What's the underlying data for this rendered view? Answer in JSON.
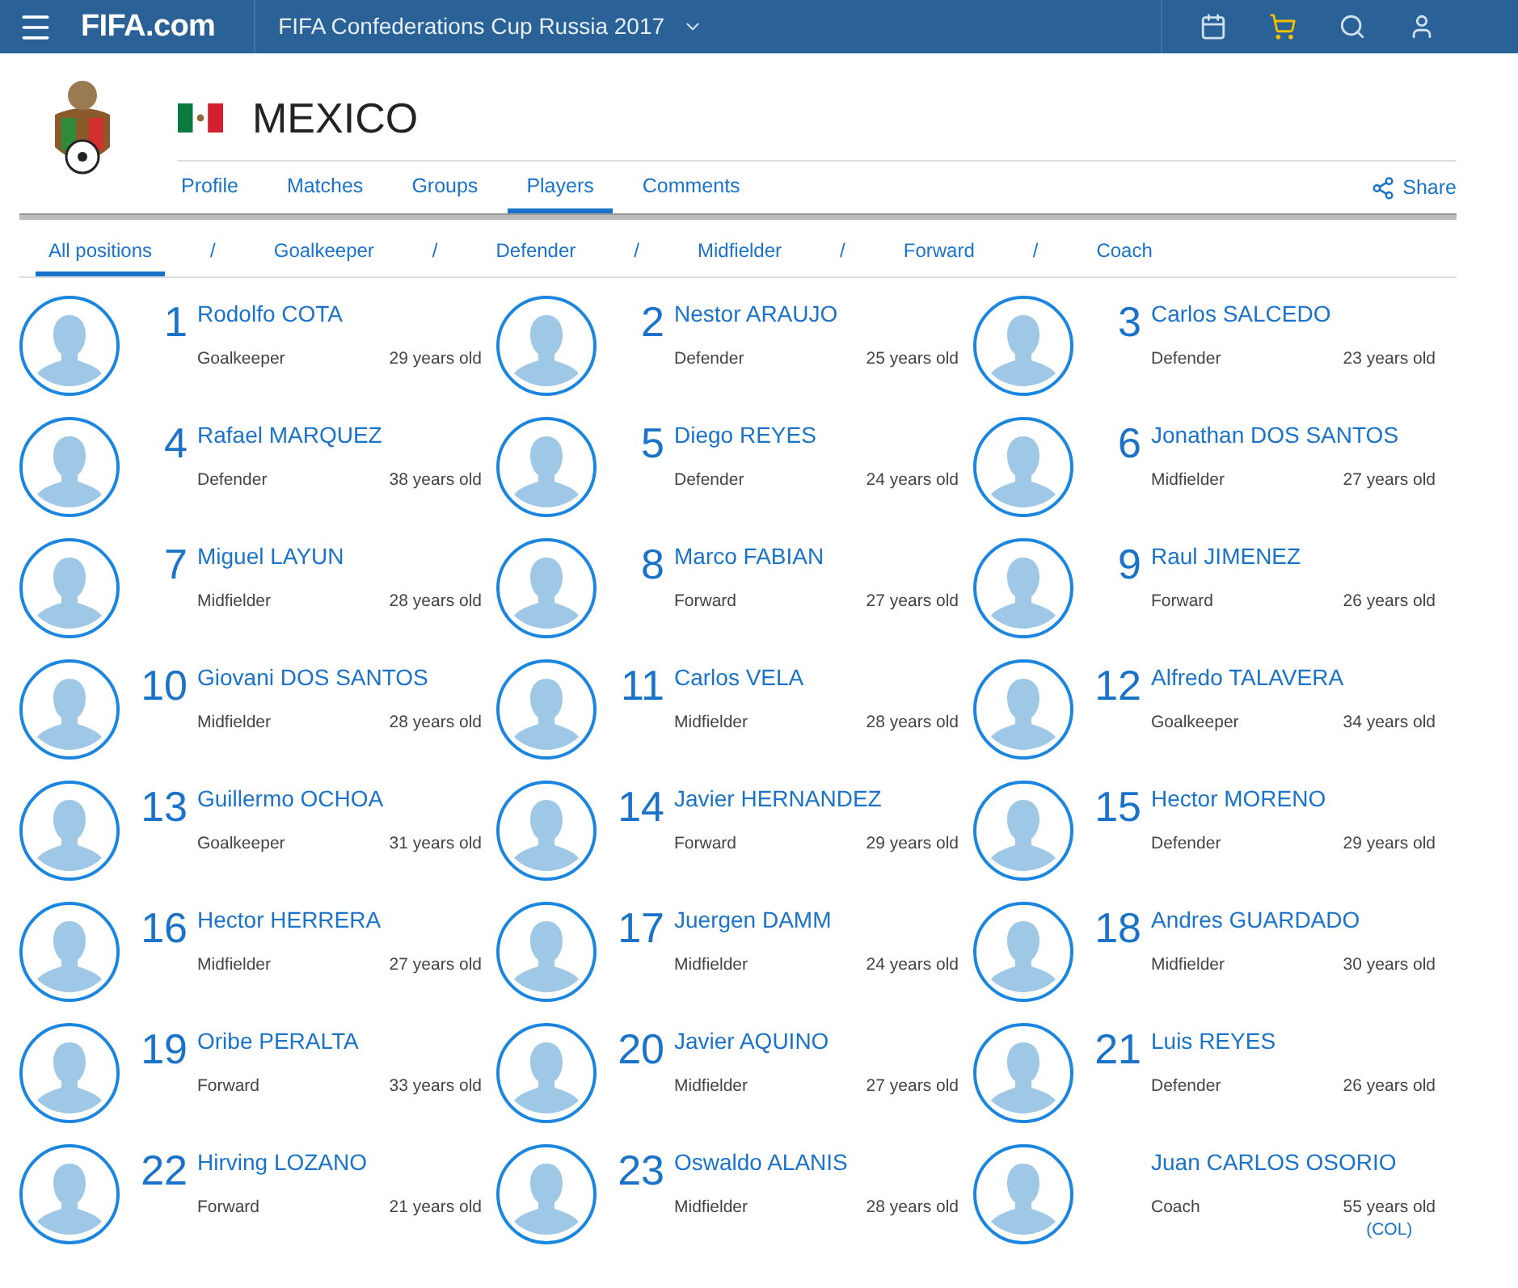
{
  "topbar": {
    "brand": "FIFA.com",
    "event": "FIFA Confederations Cup Russia 2017"
  },
  "team": {
    "name": "MEXICO"
  },
  "tabs": [
    {
      "label": "Profile",
      "selected": false
    },
    {
      "label": "Matches",
      "selected": false
    },
    {
      "label": "Groups",
      "selected": false
    },
    {
      "label": "Players",
      "selected": true
    },
    {
      "label": "Comments",
      "selected": false
    }
  ],
  "share": "Share",
  "filters": [
    {
      "label": "All positions",
      "selected": true
    },
    {
      "label": "Goalkeeper",
      "selected": false
    },
    {
      "label": "Defender",
      "selected": false
    },
    {
      "label": "Midfielder",
      "selected": false
    },
    {
      "label": "Forward",
      "selected": false
    },
    {
      "label": "Coach",
      "selected": false
    }
  ],
  "separator": "/",
  "players": [
    {
      "number": "1",
      "name": "Rodolfo COTA",
      "position": "Goalkeeper",
      "age": "29 years old"
    },
    {
      "number": "2",
      "name": "Nestor ARAUJO",
      "position": "Defender",
      "age": "25 years old"
    },
    {
      "number": "3",
      "name": "Carlos SALCEDO",
      "position": "Defender",
      "age": "23 years old"
    },
    {
      "number": "4",
      "name": "Rafael MARQUEZ",
      "position": "Defender",
      "age": "38 years old"
    },
    {
      "number": "5",
      "name": "Diego REYES",
      "position": "Defender",
      "age": "24 years old"
    },
    {
      "number": "6",
      "name": "Jonathan DOS SANTOS",
      "position": "Midfielder",
      "age": "27 years old"
    },
    {
      "number": "7",
      "name": "Miguel LAYUN",
      "position": "Midfielder",
      "age": "28 years old"
    },
    {
      "number": "8",
      "name": "Marco FABIAN",
      "position": "Forward",
      "age": "27 years old"
    },
    {
      "number": "9",
      "name": "Raul JIMENEZ",
      "position": "Forward",
      "age": "26 years old"
    },
    {
      "number": "10",
      "name": "Giovani DOS SANTOS",
      "position": "Midfielder",
      "age": "28 years old"
    },
    {
      "number": "11",
      "name": "Carlos VELA",
      "position": "Midfielder",
      "age": "28 years old"
    },
    {
      "number": "12",
      "name": "Alfredo TALAVERA",
      "position": "Goalkeeper",
      "age": "34 years old"
    },
    {
      "number": "13",
      "name": "Guillermo OCHOA",
      "position": "Goalkeeper",
      "age": "31 years old"
    },
    {
      "number": "14",
      "name": "Javier HERNANDEZ",
      "position": "Forward",
      "age": "29 years old"
    },
    {
      "number": "15",
      "name": "Hector MORENO",
      "position": "Defender",
      "age": "29 years old"
    },
    {
      "number": "16",
      "name": "Hector HERRERA",
      "position": "Midfielder",
      "age": "27 years old"
    },
    {
      "number": "17",
      "name": "Juergen DAMM",
      "position": "Midfielder",
      "age": "24 years old"
    },
    {
      "number": "18",
      "name": "Andres GUARDADO",
      "position": "Midfielder",
      "age": "30 years old"
    },
    {
      "number": "19",
      "name": "Oribe PERALTA",
      "position": "Forward",
      "age": "33 years old"
    },
    {
      "number": "20",
      "name": "Javier AQUINO",
      "position": "Midfielder",
      "age": "27 years old"
    },
    {
      "number": "21",
      "name": "Luis REYES",
      "position": "Defender",
      "age": "26 years old"
    },
    {
      "number": "22",
      "name": "Hirving LOZANO",
      "position": "Forward",
      "age": "21 years old"
    },
    {
      "number": "23",
      "name": "Oswaldo ALANIS",
      "position": "Midfielder",
      "age": "28 years old"
    },
    {
      "name": "Juan CARLOS OSORIO",
      "position": "Coach",
      "age": "55 years old",
      "nationality": "(COL)"
    }
  ]
}
